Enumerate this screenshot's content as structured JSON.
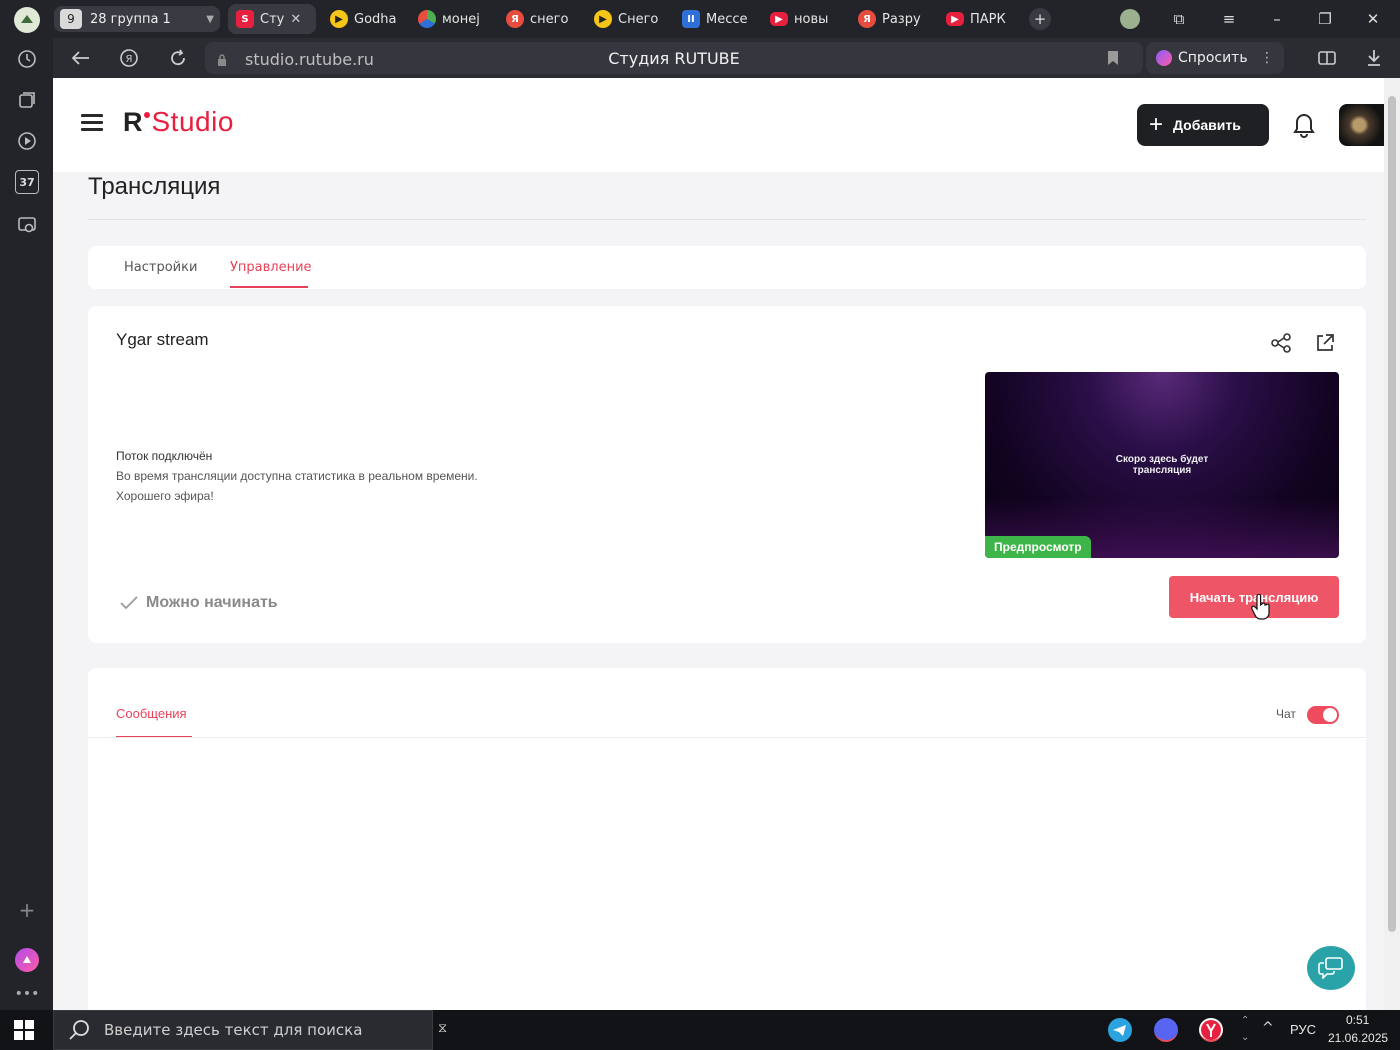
{
  "browser": {
    "tab_group": {
      "count": "9",
      "label": "28 группа 1"
    },
    "tabs": [
      {
        "label": "Сту",
        "color": "#e8203f",
        "glyph": "S"
      },
      {
        "label": "Godha",
        "color": "#f5c518",
        "glyph": "▶"
      },
      {
        "label": "монеј",
        "color": "#4cb050",
        "glyph": "●"
      },
      {
        "label": "снего",
        "color": "#e84c3d",
        "glyph": "Я"
      },
      {
        "label": "Снего",
        "color": "#f5c518",
        "glyph": "▶"
      },
      {
        "label": "Мессе",
        "color": "#2f6fd8",
        "glyph": "II"
      },
      {
        "label": "новы",
        "color": "#e8203f",
        "glyph": "▶"
      },
      {
        "label": "Разру",
        "color": "#e84c3d",
        "glyph": "Я"
      },
      {
        "label": "ПАРК",
        "color": "#e8203f",
        "glyph": "▶"
      }
    ],
    "url": "studio.rutube.ru",
    "page_title": "Студия RUTUBE",
    "ask_label": "Спросить",
    "rail_badge": "37"
  },
  "site": {
    "logo_r": "R",
    "logo_studio": "Studio",
    "add_label": "Добавить",
    "heading": "Трансляция",
    "subtabs": [
      "Настройки",
      "Управление"
    ],
    "stream": {
      "title": "Ygar stream",
      "status_title": "Поток подключён",
      "status_line2": "Во время трансляции доступна статистика в реальном времени.",
      "status_line3": "Хорошего эфира!",
      "ready_label": "Можно начинать",
      "preview_caption_1": "Скоро здесь будет",
      "preview_caption_2": "трансляция",
      "preview_badge": "Предпросмотр",
      "start_label": "Начать трансляцию"
    },
    "chat": {
      "tab_label": "Сообщения",
      "toggle_label": "Чат",
      "toggle_on": true
    }
  },
  "taskbar": {
    "search_placeholder": "Введите здесь текст для поиска",
    "lang": "РУС",
    "time": "0:51",
    "date": "21.06.2025"
  },
  "colors": {
    "accent": "#e8425a",
    "start_button": "#ee5567",
    "preview_badge": "#3db548",
    "fab": "#2aa3a8"
  }
}
